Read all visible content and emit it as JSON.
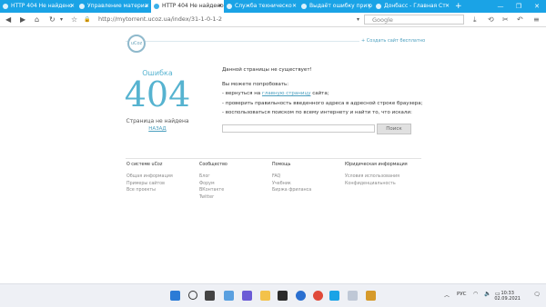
{
  "tabs": [
    {
      "label": "HTTP 404 Не найдено"
    },
    {
      "label": "Управление материа"
    },
    {
      "label": "HTTP 404 Не найдено"
    },
    {
      "label": "Служба техническо"
    },
    {
      "label": "Выдаёт ошибку при р"
    },
    {
      "label": "Донбасс - Главная Ст"
    }
  ],
  "nav": {
    "url": "http://mytorrent.ucoz.ua/index/31-1-0-1-2",
    "search_placeholder": "Google"
  },
  "header": {
    "logo_text": "uCoz",
    "create_site": "Создать сайт бесплатно"
  },
  "error": {
    "title": "Ошибка",
    "code": "404",
    "subtitle": "Страница не найдена",
    "back": "НАЗАД"
  },
  "message": {
    "heading": "Данной страницы не существует!",
    "try_label": "Вы можете попробовать:",
    "item1_prefix": "- вернуться на ",
    "item1_link": "главную страницу",
    "item1_suffix": " сайта;",
    "item2": "- проверить правильность введенного адреса в адресной строке браузера;",
    "item3": "- воспользоваться поиском по всему интернету и найти то, что искали:",
    "search_button": "Поиск"
  },
  "footer": {
    "col1": {
      "heading": "О системе uCoz",
      "items": [
        "Общая информация",
        "Примеры сайтов",
        "Все проекты"
      ]
    },
    "col2": {
      "heading": "Сообщество",
      "items": [
        "Блог",
        "Форум",
        "ВКонтакте",
        "Twitter"
      ]
    },
    "col3": {
      "heading": "Помощь",
      "items": [
        "FAQ",
        "Учебник",
        "Биржа фриланса"
      ]
    },
    "col4": {
      "heading": "Юридическая информация",
      "items": [
        "Условия использования",
        "Конфиденциальность"
      ]
    }
  },
  "taskbar": {
    "lang": "РУС",
    "time": "10:33",
    "date": "02.09.2021"
  },
  "colors": {
    "accent": "#1aa3e6",
    "error_blue": "#56b3d0",
    "link": "#4b9fbf"
  }
}
